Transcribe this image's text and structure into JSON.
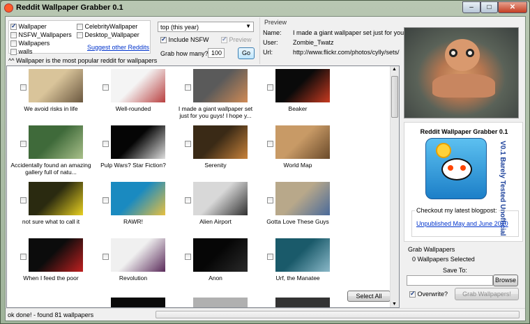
{
  "window": {
    "title": "Reddit Wallpaper Grabber 0.1",
    "minimize": "–",
    "maximize": "□",
    "close": "✕"
  },
  "subreddits": {
    "items": [
      {
        "label": "Wallpaper",
        "checked": true
      },
      {
        "label": "NSFW_Wallpapers",
        "checked": false
      },
      {
        "label": "Wallpapers",
        "checked": false
      },
      {
        "label": "walls",
        "checked": false
      },
      {
        "label": "CelebrityWallpaper",
        "checked": false
      },
      {
        "label": "Desktop_Wallpaper",
        "checked": false
      }
    ],
    "suggest_link": "Suggest other Reddits",
    "footnote": "^^ Wallpaper is the most popular reddit for wallpapers"
  },
  "options": {
    "period_value": "top (this year)",
    "include_nsfw_label": "Include NSFW",
    "include_nsfw_checked": true,
    "preview_label": "Preview",
    "preview_checked": true,
    "grab_label": "Grab how many?",
    "grab_value": "100",
    "go_label": "Go"
  },
  "preview": {
    "heading": "Preview",
    "name_label": "Name:",
    "name_value": "I made a giant wallpaper set just for you",
    "user_label": "User:",
    "user_value": "Zombie_Twatz",
    "url_label": "Url:",
    "url_value": "http://www.flickr.com/photos/cylly/sets/"
  },
  "wallpapers": [
    {
      "caption": "We avoid risks in life",
      "colors": [
        "#d9c49a",
        "#6b5840"
      ]
    },
    {
      "caption": "Well-rounded",
      "colors": [
        "#f4f4f4",
        "#b94040"
      ]
    },
    {
      "caption": "I made a giant wallpaper set just for you guys! I hope y...",
      "colors": [
        "#5a5a5a",
        "#d08a55"
      ]
    },
    {
      "caption": "Beaker",
      "colors": [
        "#0a0a0a",
        "#c83a20"
      ]
    },
    {
      "caption": "Accidentally found an amazing gallery full of natu...",
      "colors": [
        "#3f6a3a",
        "#a9c08a"
      ]
    },
    {
      "caption": "Pulp Wars? Star Fiction?",
      "colors": [
        "#050505",
        "#dedede"
      ]
    },
    {
      "caption": "Serenity",
      "colors": [
        "#3a2a16",
        "#c8823a"
      ]
    },
    {
      "caption": "World Map",
      "colors": [
        "#c89a66",
        "#6a4a2a"
      ]
    },
    {
      "caption": "not sure what to call it",
      "colors": [
        "#2a2a10",
        "#e8d020"
      ]
    },
    {
      "caption": "RAWR!",
      "colors": [
        "#1a8ac0",
        "#e8c040"
      ]
    },
    {
      "caption": "Alien Airport",
      "colors": [
        "#d8d8d8",
        "#303030"
      ]
    },
    {
      "caption": "Gotta Love These Guys",
      "colors": [
        "#b8a88a",
        "#4a6a9a"
      ]
    },
    {
      "caption": "When I feed the poor",
      "colors": [
        "#0c0c0c",
        "#c02020"
      ]
    },
    {
      "caption": "Revolution",
      "colors": [
        "#f0f0f0",
        "#5a2a5a"
      ]
    },
    {
      "caption": "Anon",
      "colors": [
        "#060606",
        "#2a2a2a"
      ]
    },
    {
      "caption": "Urf, the Manatee",
      "colors": [
        "#1a5a6a",
        "#8ab8c8"
      ]
    }
  ],
  "bottom_row_colors": [
    "#ffffff",
    "#0a0a0a",
    "#b0b0b0",
    "#333333"
  ],
  "select_all_label": "Select All",
  "blogpost": {
    "ad_title": "Reddit Wallpaper Grabber 0.1",
    "ad_vertical": "V0.1 Barely Tested Unofficial",
    "legend": "Checkout my latest blogpost:",
    "link": "Unpublished May and June 2010"
  },
  "grab": {
    "heading": "Grab Wallpapers",
    "selected_text": "0 Wallpapers Selected",
    "save_to_label": "Save To:",
    "save_to_value": "",
    "browse_label": "Browse",
    "overwrite_label": "Overwrite?",
    "overwrite_checked": true,
    "grab_button": "Grab Wallpapers!"
  },
  "status": {
    "text": "ok done! - found 81 wallpapers",
    "progress": 0
  }
}
